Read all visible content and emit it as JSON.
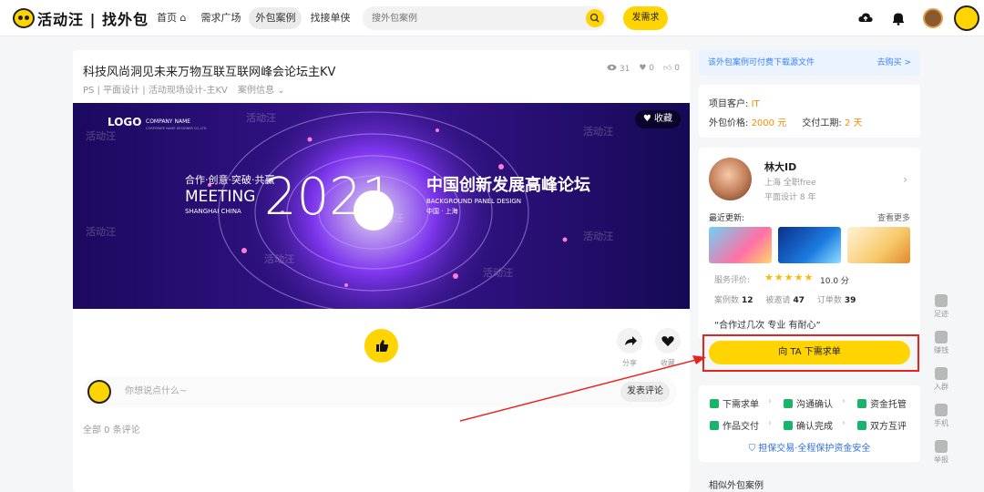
{
  "header": {
    "logo_text": "活动汪 | 找外包",
    "nav": [
      {
        "label": "首页 ⌂"
      },
      {
        "label": "需求广场"
      },
      {
        "label": "外包案例"
      },
      {
        "label": "找接单侠"
      }
    ],
    "search_placeholder": "搜外包案例",
    "post_button": "发需求"
  },
  "case": {
    "title": "科技风尚洞见未来万物互联互联网峰会论坛主KV",
    "views": "31",
    "hearts": "0",
    "likes": "0",
    "tags": "PS | 平面设计 | 活动现场设计-主KV",
    "case_info": "案例信息",
    "collect_label": "收藏",
    "share_label": "分享",
    "collect_action_label": "收藏",
    "comment_placeholder": "你想说点什么~",
    "comment_submit": "发表评论",
    "all_comments": "全部 0 条评论",
    "banner": {
      "logo": "LOGO",
      "company_name": "COMPANY NAME",
      "company_sub": "CORPORATE NAME DESIGNER CO.,LTD",
      "slogan": "合作·创意·突破·共赢",
      "meeting": "MEETING",
      "location": "SHANGHAI CHINA",
      "year": "2021",
      "headline": "中国创新发展高峰论坛",
      "sub_en": "BACKGROUND PANEL DESIGN",
      "sub_cn": "中国 · 上海",
      "watermark": "活动汪"
    }
  },
  "sidebar": {
    "notice": "该外包案例可付费下载源文件",
    "notice_action": "去购买 >",
    "client_label": "项目客户:",
    "client_value": "IT",
    "price_label": "外包价格:",
    "price_value": "2000 元",
    "period_label": "交付工期:",
    "period_value": "2 天",
    "designer": {
      "name": "林大ID",
      "location": "上海 全职free",
      "experience": "平面设计 8 年",
      "recent_label": "最近更新:",
      "more_label": "查看更多",
      "score_label": "服务评价:",
      "stars": "★★★★★",
      "score": "10.0 分",
      "cases_label": "案例数",
      "cases": "12",
      "invited_label": "被邀请",
      "invited": "47",
      "orders_label": "订单数",
      "orders": "39",
      "quote": "“合作过几次 专业 有耐心”"
    },
    "order_button": "向 TA 下需求单",
    "flow": {
      "step1": "下需求单",
      "step2": "沟通确认",
      "step3": "资金托管",
      "step4": "作品交付",
      "step5": "确认完成",
      "step6": "双方互评",
      "safe": "担保交易·全程保护资金安全"
    },
    "similar_title": "相似外包案例"
  },
  "float_bar": [
    {
      "label": "足迹"
    },
    {
      "label": "赚钱"
    },
    {
      "label": "入群"
    },
    {
      "label": "手机"
    },
    {
      "label": "举报"
    }
  ],
  "colors": {
    "accent": "#ffd400",
    "highlight": "#e8231f",
    "link": "#3b82f6",
    "price": "#ff8a00"
  }
}
